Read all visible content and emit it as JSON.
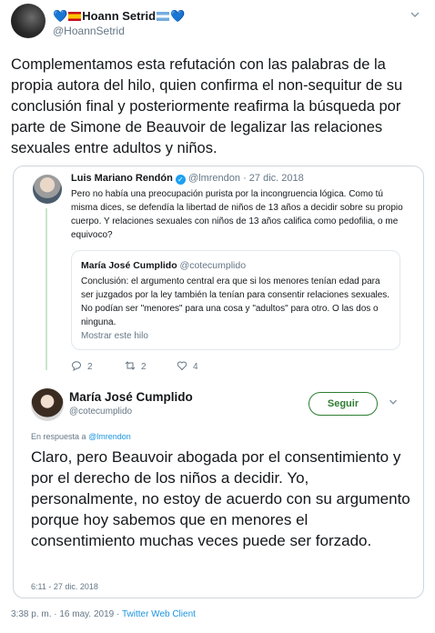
{
  "tweet": {
    "author": {
      "name_prefix": "💙",
      "name": "Hoann Setrid",
      "name_suffix": "💙",
      "handle": "@HoannSetrid"
    },
    "text": "Complementamos esta refutación con las palabras de la propia autora del hilo, quien confirma el non-sequitur de su conclusión final y posteriormente reafirma la búsqueda por parte de Simone de Beauvoir de legalizar las relaciones sexuales entre adultos y niños.",
    "timestamp": "3:38 p. m. · 16 may. 2019",
    "separator": "·",
    "client": "Twitter Web Client"
  },
  "quoted_parent": {
    "name": "Luis Mariano Rendón",
    "handle": "@lmrendon",
    "date": "· 27 dic. 2018",
    "text": "Pero no había una preocupación purista por la incongruencia lógica. Como tú misma dices, se defendía la libertad de niños de 13 años a decidir sobre su propio cuerpo. Y relaciones sexuales con niños de 13 años califica como pedofilia, o me equivoco?",
    "inner_quote": {
      "name": "María José Cumplido",
      "handle": "@cotecumplido",
      "text": "Conclusión: el argumento central era que si los menores tenían edad para ser juzgados por la ley también la tenían para consentir relaciones sexuales. No podían ser \"menores\" para una cosa y \"adultos\" para otro. O las dos o ninguna.",
      "show_thread": "Mostrar este hilo"
    },
    "actions": {
      "reply_count": "2",
      "retweet_count": "2",
      "like_count": "4"
    }
  },
  "quoted_reply": {
    "name": "María José Cumplido",
    "handle": "@cotecumplido",
    "follow_label": "Seguir",
    "reply_prefix": "En respuesta a",
    "reply_to": "@lmrendon",
    "text": "Claro, pero Beauvoir abogada por el consentimiento y por el derecho de los niños a decidir. Yo, personalmente, no estoy de acuerdo con su argumento porque hoy sabemos que en menores el consentimiento muchas veces puede ser forzado.",
    "time": "6:11 - 27 dic. 2018"
  },
  "colors": {
    "link": "#1b95e0",
    "follow": "#2e7d32",
    "thread_line": "#c8e6c9",
    "muted": "#657786"
  }
}
